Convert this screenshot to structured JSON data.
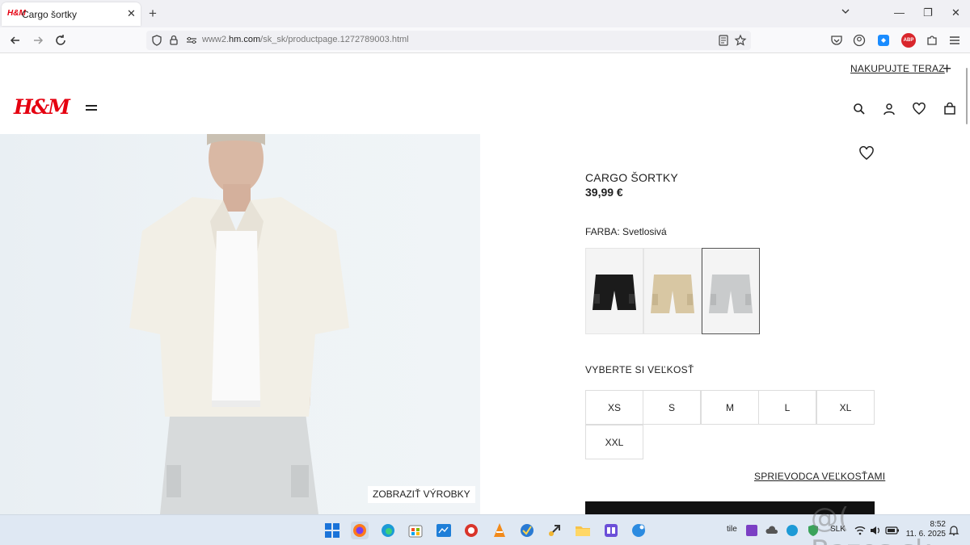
{
  "browser": {
    "tab_title": "Cargo šortky",
    "tab_favicon": "H&M",
    "url_host": "www2.hm.com",
    "url_prefix": "www2.",
    "url_domain": "hm.com",
    "url_path": "/sk_sk/productpage.1272789003.html",
    "icons": [
      "back-icon",
      "forward-icon",
      "reload-icon",
      "shield-icon",
      "lock-icon",
      "permissions-icon",
      "reader-icon",
      "star-icon",
      "pocket-icon",
      "account-icon",
      "extension-icon",
      "adblock-icon",
      "puzzle-icon",
      "menu-icon"
    ],
    "adblock_label": "ABP"
  },
  "header": {
    "shop_now": "NAKUPUJTE TERAZ",
    "logo": "H&M"
  },
  "hero": {
    "show_products": "ZOBRAZIŤ VÝROBKY"
  },
  "product": {
    "title": "CARGO ŠORTKY",
    "price": "39,99 €",
    "color_label": "FARBA: Svetlosivá",
    "swatches": [
      {
        "name": "black",
        "color": "#1b1b1b"
      },
      {
        "name": "beige",
        "color": "#d8c7a3"
      },
      {
        "name": "light-grey",
        "color": "#c9cbcc"
      }
    ],
    "size_label": "VYBERTE SI VEĽKOSŤ",
    "sizes": [
      "XS",
      "S",
      "M",
      "L",
      "XL",
      "XXL"
    ],
    "size_guide": "SPRIEVODCA VEĽKOSŤAMI"
  },
  "taskbar": {
    "tray_text": "tile",
    "language": "SLK",
    "time": "8:52",
    "date": "11. 6. 2025"
  },
  "watermark": "@( Bazos.sk",
  "colors": {
    "brand_red": "#e50010",
    "text": "#222222",
    "taskbar": "#dfe8f3"
  }
}
